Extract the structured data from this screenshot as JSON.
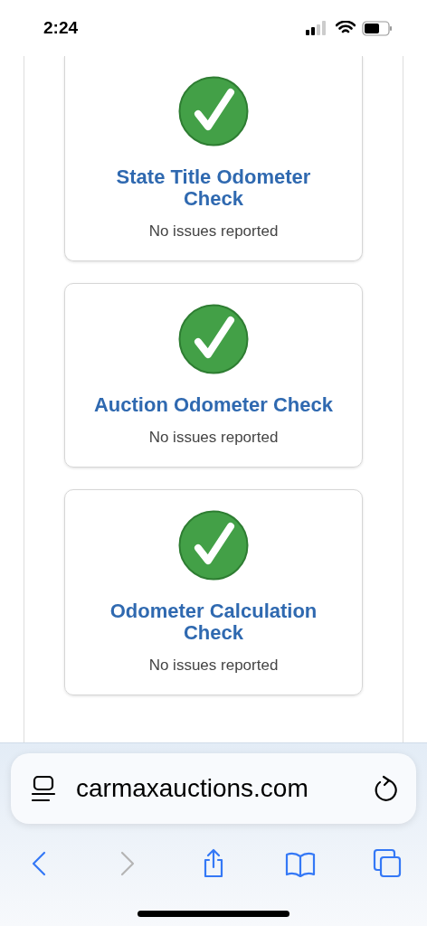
{
  "status_bar": {
    "time": "2:24"
  },
  "checks": [
    {
      "title": "State Title Odometer Check",
      "result": "No issues reported",
      "passed": true
    },
    {
      "title": "Auction Odometer Check",
      "result": "No issues reported",
      "passed": true
    },
    {
      "title": "Odometer Calculation Check",
      "result": "No issues reported",
      "passed": true
    }
  ],
  "address_bar": {
    "url": "carmaxauctions.com"
  },
  "toolbar": [
    {
      "kind": "back",
      "disabled": false
    },
    {
      "kind": "forward",
      "disabled": true
    },
    {
      "kind": "share",
      "disabled": false
    },
    {
      "kind": "bookmarks",
      "disabled": false
    },
    {
      "kind": "tabs",
      "disabled": false
    }
  ]
}
